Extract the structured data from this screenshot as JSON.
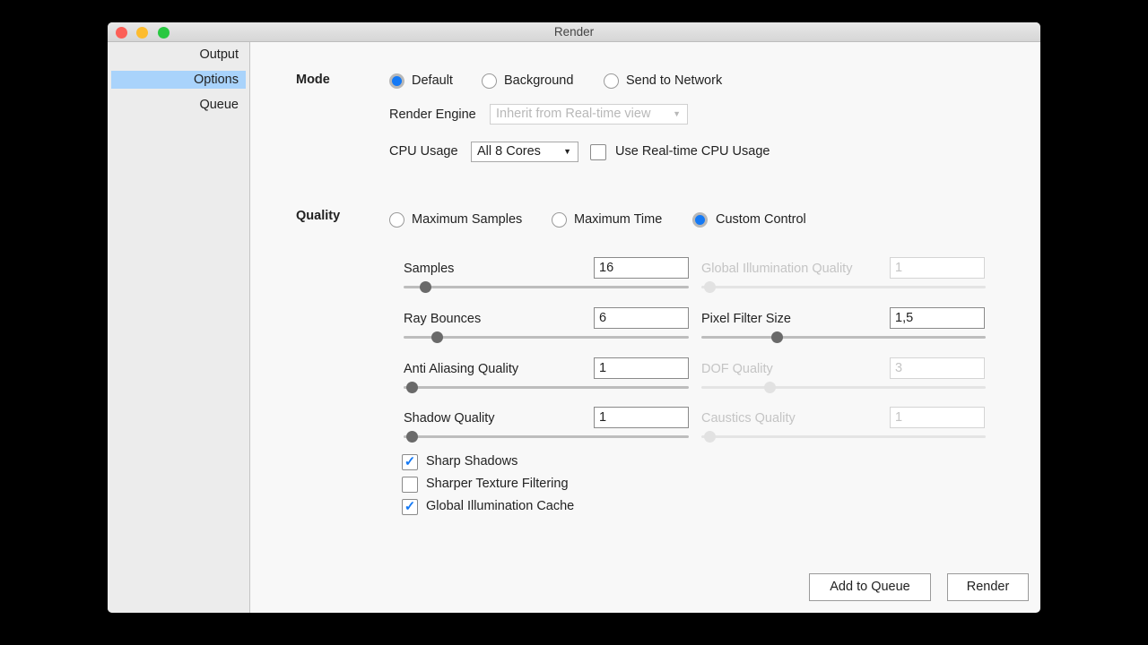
{
  "window": {
    "title": "Render"
  },
  "sidebar": {
    "items": [
      {
        "label": "Output",
        "selected": false
      },
      {
        "label": "Options",
        "selected": true
      },
      {
        "label": "Queue",
        "selected": false
      }
    ]
  },
  "mode": {
    "label": "Mode",
    "options": [
      "Default",
      "Background",
      "Send to Network"
    ],
    "selected": "Default",
    "render_engine_label": "Render Engine",
    "render_engine_value": "Inherit from Real-time view",
    "cpu_label": "CPU Usage",
    "cpu_value": "All 8 Cores",
    "realtime_cpu_label": "Use Real-time CPU Usage",
    "realtime_cpu_checked": false
  },
  "quality": {
    "label": "Quality",
    "options": [
      "Maximum Samples",
      "Maximum Time",
      "Custom Control"
    ],
    "selected": "Custom Control",
    "params": [
      {
        "label": "Samples",
        "value": "16",
        "slider": 0.075,
        "enabled": true
      },
      {
        "label": "Global Illumination Quality",
        "value": "1",
        "slider": 0.0,
        "enabled": false
      },
      {
        "label": "Ray Bounces",
        "value": "6",
        "slider": 0.116,
        "enabled": true
      },
      {
        "label": "Pixel Filter Size",
        "value": "1,5",
        "slider": 0.265,
        "enabled": true
      },
      {
        "label": "Anti Aliasing Quality",
        "value": "1",
        "slider": 0.0,
        "enabled": true
      },
      {
        "label": "DOF Quality",
        "value": "3",
        "slider": 0.24,
        "enabled": false
      },
      {
        "label": "Shadow Quality",
        "value": "1",
        "slider": 0.0,
        "enabled": true
      },
      {
        "label": "Caustics Quality",
        "value": "1",
        "slider": 0.0,
        "enabled": false
      }
    ],
    "checkboxes": [
      {
        "label": "Sharp Shadows",
        "checked": true
      },
      {
        "label": "Sharper Texture Filtering",
        "checked": false
      },
      {
        "label": "Global Illumination Cache",
        "checked": true
      }
    ]
  },
  "buttons": {
    "add_to_queue": "Add to Queue",
    "render": "Render"
  },
  "colors": {
    "accent": "#1479f5",
    "sidebar_selection": "#a9d3fb"
  }
}
